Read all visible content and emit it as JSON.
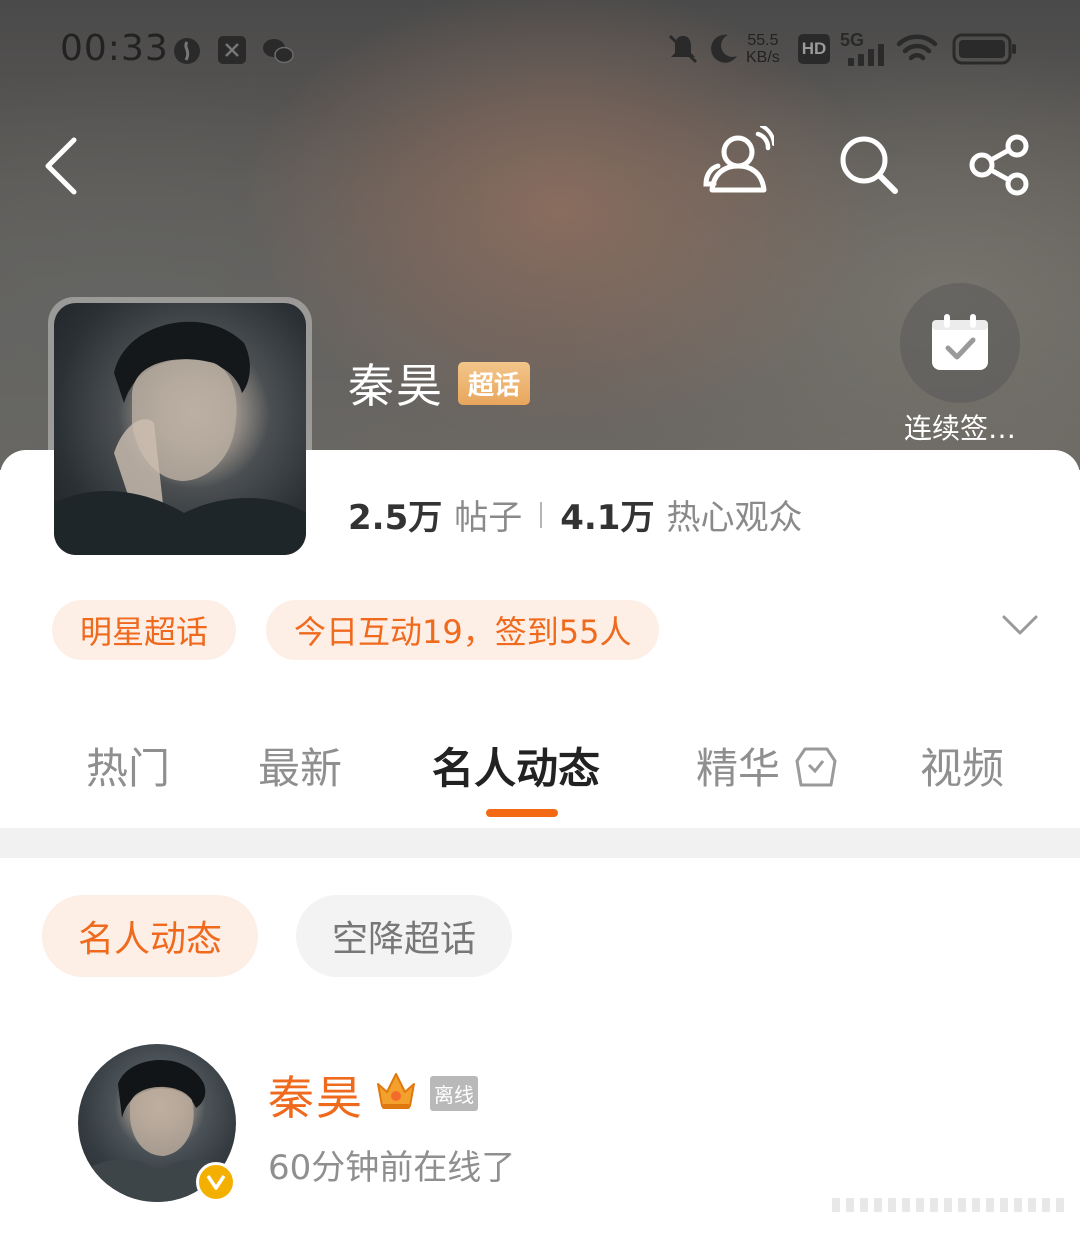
{
  "status_bar": {
    "time": "00:33",
    "net_speed_value": "55.5",
    "net_speed_unit": "KB/s",
    "network": "5G",
    "hd_label": "HD"
  },
  "header": {
    "topic_name": "秦昊",
    "topic_badge": "超话",
    "checkin_label": "连续签…"
  },
  "stats": {
    "posts_value": "2.5万",
    "posts_label": "帖子",
    "fans_value": "4.1万",
    "fans_label": "热心观众"
  },
  "tags": [
    {
      "label": "明星超话"
    },
    {
      "label": "今日互动19，签到55人"
    }
  ],
  "tabs": [
    {
      "label": "热门"
    },
    {
      "label": "最新"
    },
    {
      "label": "名人动态",
      "active": true
    },
    {
      "label": "精华"
    },
    {
      "label": "视频"
    }
  ],
  "subtabs": [
    {
      "label": "名人动态",
      "active": true
    },
    {
      "label": "空降超话"
    }
  ],
  "user_card": {
    "name": "秦昊",
    "offline_badge": "离线",
    "status": "60分钟前在线了"
  },
  "colors": {
    "accent": "#f06a1e",
    "badge_gold": "#e8a65c",
    "verify_yellow": "#f4b000"
  },
  "icons": [
    "back-icon",
    "fan-group-icon",
    "search-icon",
    "share-icon",
    "calendar-check-icon",
    "chevron-down-icon",
    "badge-icon",
    "crown-icon",
    "verified-icon"
  ]
}
